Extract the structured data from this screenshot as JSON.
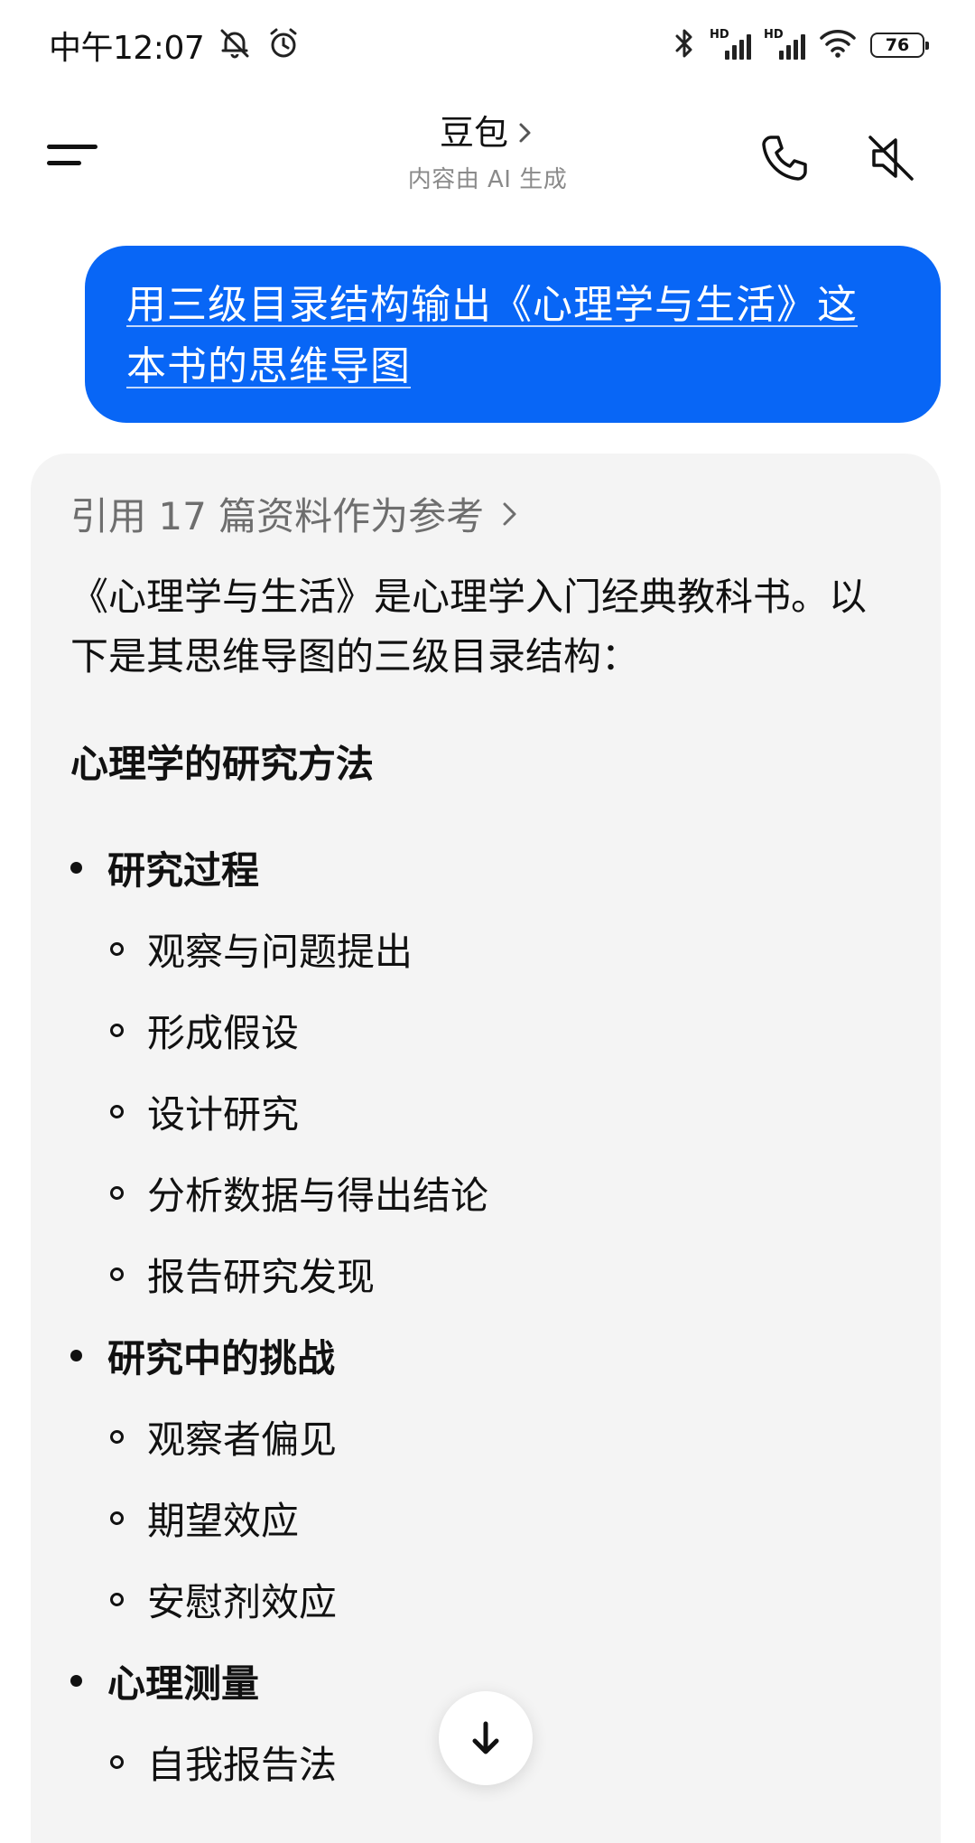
{
  "status_bar": {
    "time": "中午12:07",
    "battery": "76"
  },
  "header": {
    "title": "豆包",
    "subtitle": "内容由 AI 生成"
  },
  "user_message": {
    "text": "用三级目录结构输出《心理学与生活》这本书的思维导图"
  },
  "answer": {
    "reference_label": "引用 17 篇资料作为参考",
    "intro": "《心理学与生活》是心理学入门经典教科书。以下是其思维导图的三级目录结构：",
    "section_title": "心理学的研究方法",
    "groups": [
      {
        "title": "研究过程",
        "items": [
          "观察与问题提出",
          "形成假设",
          "设计研究",
          "分析数据与得出结论",
          "报告研究发现"
        ]
      },
      {
        "title": "研究中的挑战",
        "items": [
          "观察者偏见",
          "期望效应",
          "安慰剂效应"
        ]
      },
      {
        "title": "心理测量",
        "items": [
          "自我报告法"
        ]
      }
    ]
  },
  "icons": {
    "silent": "bell-off-icon",
    "alarm": "alarm-icon",
    "bluetooth": "bluetooth-icon",
    "signal": "signal-icon",
    "wifi": "wifi-icon",
    "menu": "menu-icon",
    "phone": "phone-icon",
    "mute": "mute-icon",
    "scroll": "arrow-down-icon"
  },
  "colors": {
    "accent": "#0866f6",
    "card_bg": "#f4f4f4",
    "muted_text": "#8a8a8a"
  }
}
